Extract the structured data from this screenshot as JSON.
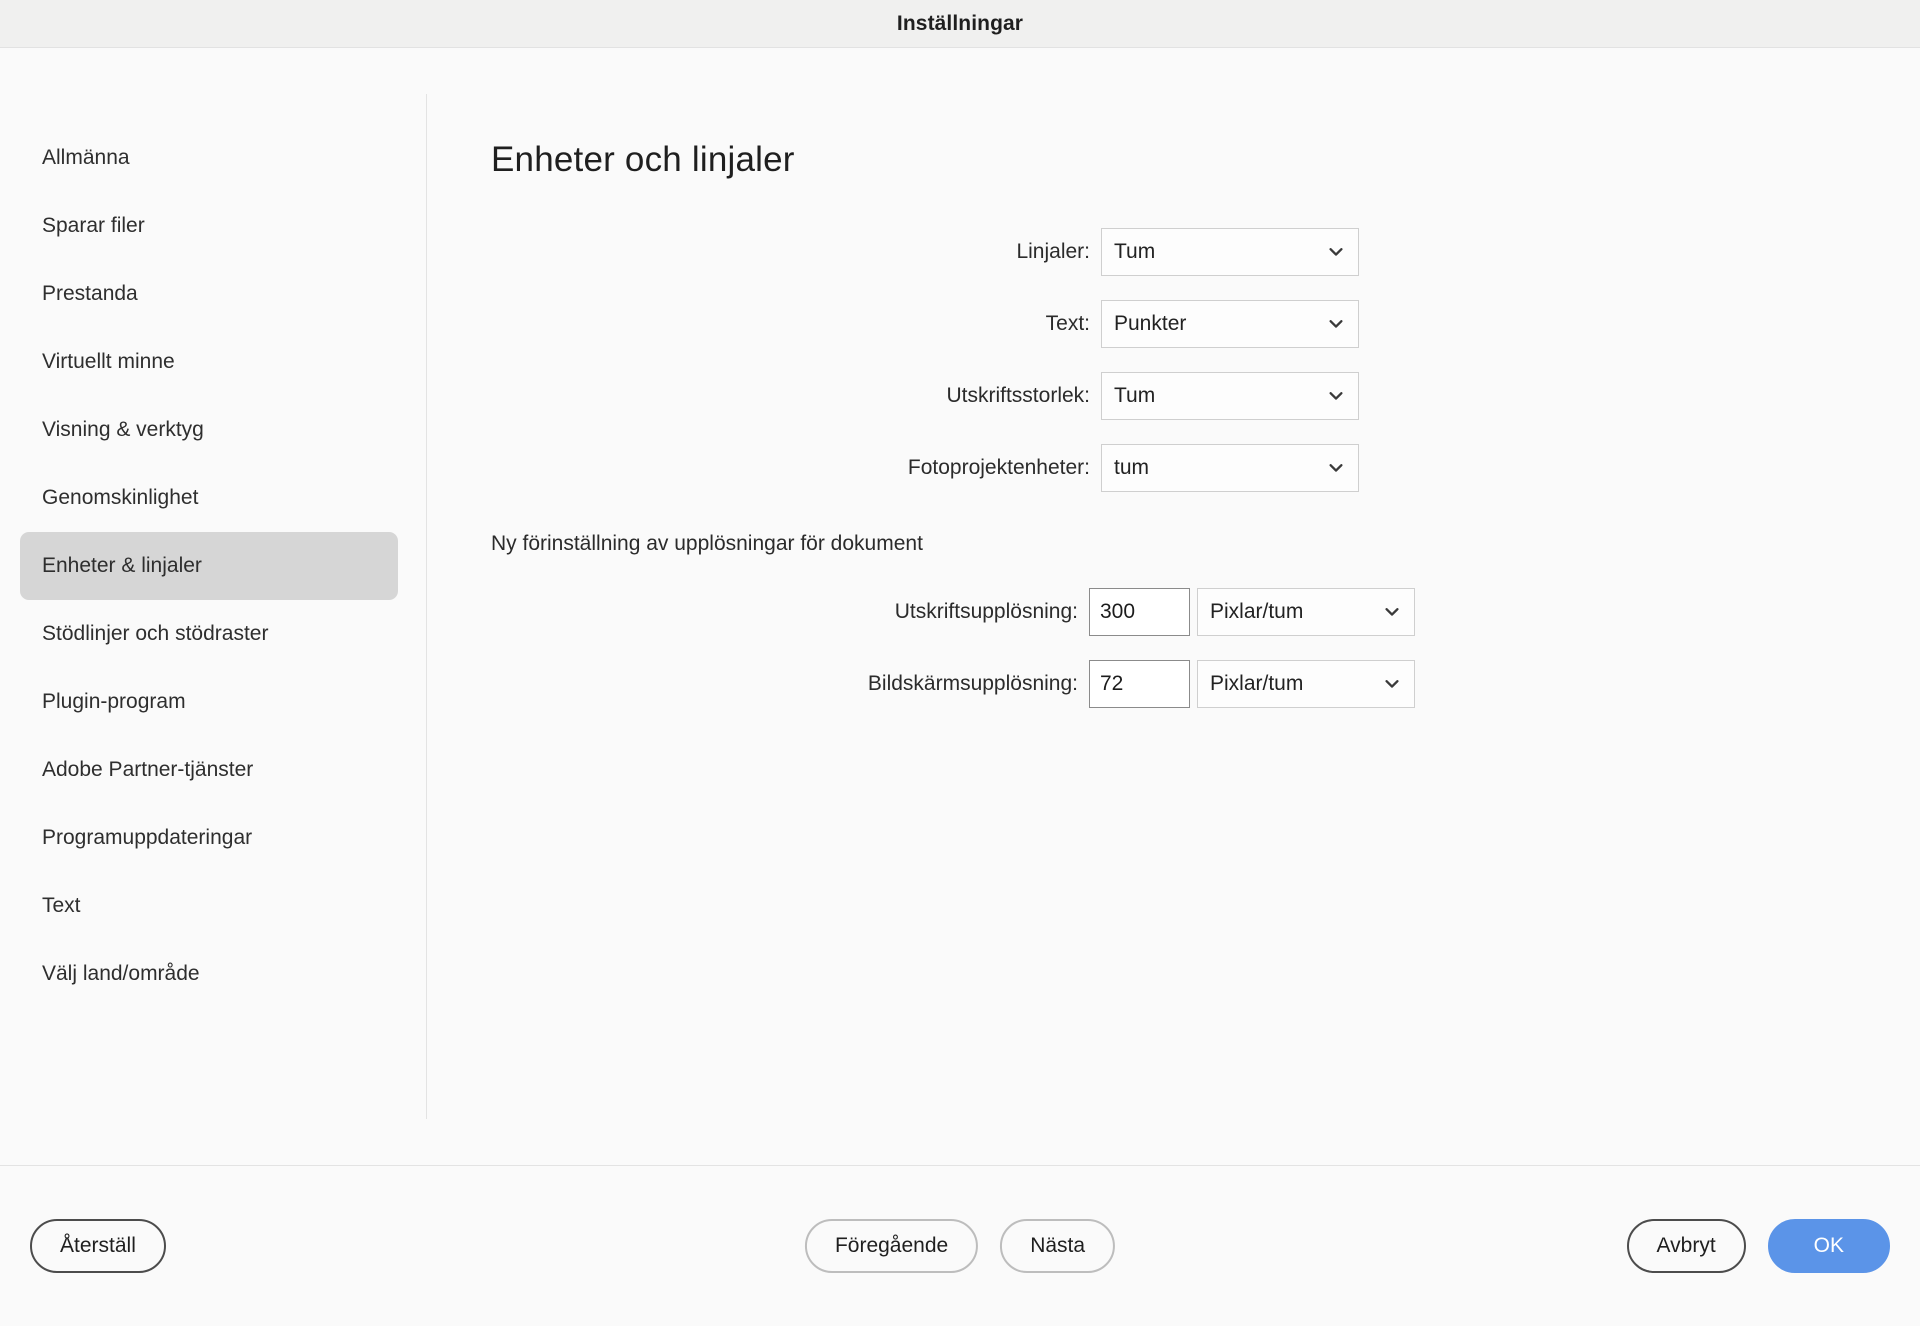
{
  "window": {
    "title": "Inställningar"
  },
  "sidebar": {
    "items": [
      {
        "label": "Allmänna",
        "selected": false
      },
      {
        "label": "Sparar filer",
        "selected": false
      },
      {
        "label": "Prestanda",
        "selected": false
      },
      {
        "label": "Virtuellt minne",
        "selected": false
      },
      {
        "label": "Visning & verktyg",
        "selected": false
      },
      {
        "label": "Genomskinlighet",
        "selected": false
      },
      {
        "label": "Enheter & linjaler",
        "selected": true
      },
      {
        "label": "Stödlinjer och stödraster",
        "selected": false
      },
      {
        "label": "Plugin-program",
        "selected": false
      },
      {
        "label": "Adobe Partner-tjänster",
        "selected": false
      },
      {
        "label": "Programuppdateringar",
        "selected": false
      },
      {
        "label": "Text",
        "selected": false
      },
      {
        "label": "Välj land/område",
        "selected": false
      }
    ]
  },
  "main": {
    "title": "Enheter och linjaler",
    "units": {
      "rulers": {
        "label": "Linjaler:",
        "value": "Tum"
      },
      "type": {
        "label": "Text:",
        "value": "Punkter"
      },
      "print_size": {
        "label": "Utskriftsstorlek:",
        "value": "Tum"
      },
      "photo_units": {
        "label": "Fotoprojektenheter:",
        "value": "tum"
      }
    },
    "presets": {
      "section_label": "Ny förinställning av upplösningar för dokument",
      "print_resolution": {
        "label": "Utskriftsupplösning:",
        "value": "300",
        "unit": "Pixlar/tum"
      },
      "screen_resolution": {
        "label": "Bildskärmsupplösning:",
        "value": "72",
        "unit": "Pixlar/tum"
      }
    }
  },
  "footer": {
    "reset": "Återställ",
    "previous": "Föregående",
    "next": "Nästa",
    "cancel": "Avbryt",
    "ok": "OK"
  },
  "colors": {
    "accent": "#5b94e8",
    "selected_nav": "#d6d6d6",
    "titlebar_bg": "#f0f0ef",
    "body_bg": "#fafafa"
  },
  "icons": {
    "chevron": "chevron-down-icon"
  }
}
